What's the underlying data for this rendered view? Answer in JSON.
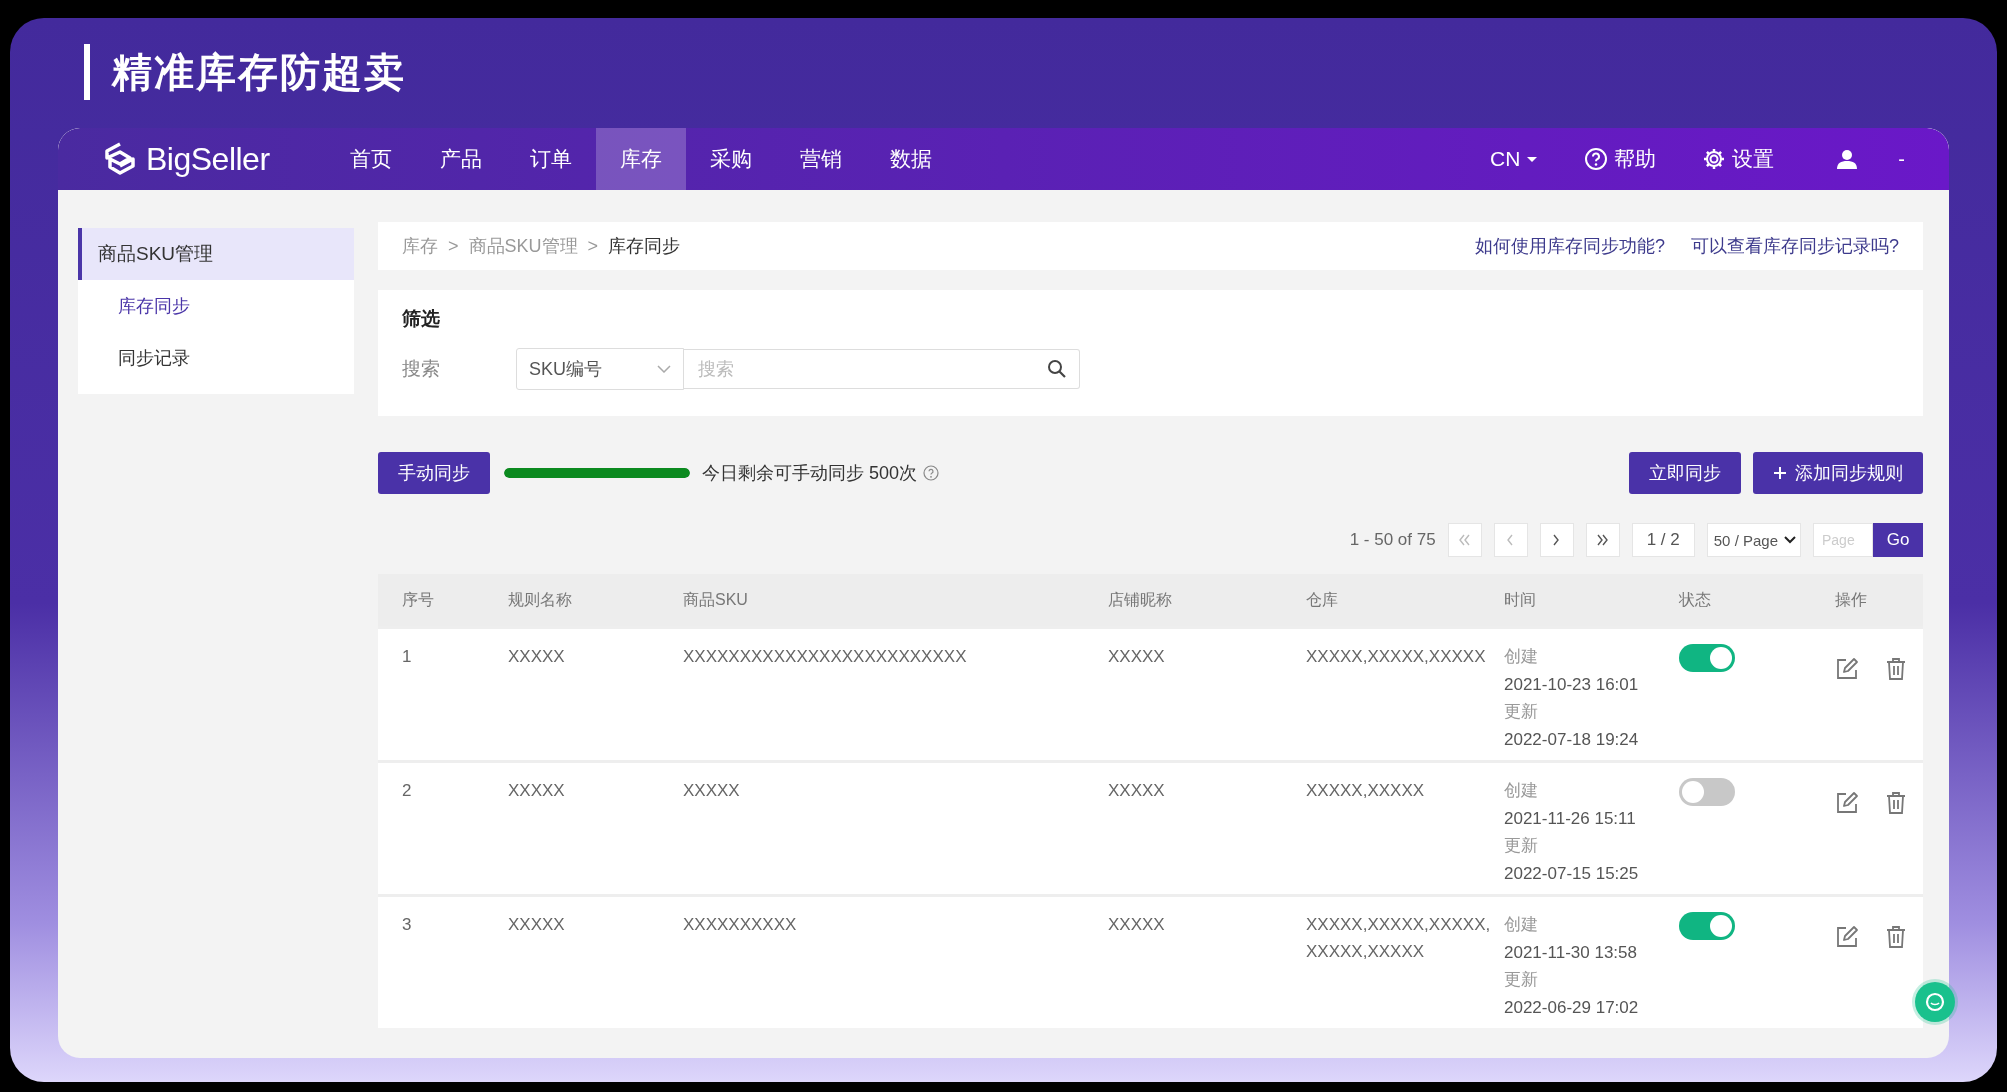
{
  "banner": {
    "title": "精准库存防超卖"
  },
  "top_nav": {
    "logo": "BigSeller",
    "items": [
      {
        "label": "首页",
        "selected": false
      },
      {
        "label": "产品",
        "selected": false
      },
      {
        "label": "订单",
        "selected": false
      },
      {
        "label": "库存",
        "selected": true
      },
      {
        "label": "采购",
        "selected": false
      },
      {
        "label": "营销",
        "selected": false
      },
      {
        "label": "数据",
        "selected": false
      }
    ],
    "language": "CN",
    "help": "帮助",
    "settings": "设置",
    "user": "-"
  },
  "sidebar": {
    "items": [
      {
        "label": "商品SKU管理",
        "selected": true,
        "children": [
          {
            "label": "库存同步",
            "selected": true
          },
          {
            "label": "同步记录",
            "selected": false
          }
        ]
      }
    ]
  },
  "breadcrumb": {
    "items": [
      "库存",
      "商品SKU管理",
      "库存同步"
    ],
    "separators": [
      ">",
      ">"
    ]
  },
  "help_links": [
    "如何使用库存同步功能?",
    "可以查看库存同步记录吗?"
  ],
  "filter": {
    "title": "筛选",
    "search_label": "搜索",
    "search_type": "SKU编号",
    "placeholder": "搜索"
  },
  "actions": {
    "manual_sync": "手动同步",
    "quota": {
      "level": 1.0,
      "text": "今日剩余可手动同步 500次"
    },
    "sync_now": "立即同步",
    "add_rule": "添加同步规则"
  },
  "pagination": {
    "range": "1 - 50 of 75",
    "page": "1 / 2",
    "page_size": "50 / Page",
    "page_placeholder": "Page",
    "go": "Go"
  },
  "table": {
    "columns": [
      "序号",
      "规则名称",
      "商品SKU",
      "店铺昵称",
      "仓库",
      "时间",
      "状态",
      "操作"
    ],
    "rows": [
      {
        "index": "1",
        "rule": "XXXXX",
        "sku": "XXXXXXXXXXXXXXXXXXXXXXXXX",
        "shop": "XXXXX",
        "warehouse": "XXXXX,XXXXX,XXXXX",
        "created_label": "创建",
        "created": "2021-10-23 16:01",
        "updated_label": "更新",
        "updated": "2022-07-18 19:24",
        "enabled": true
      },
      {
        "index": "2",
        "rule": "XXXXX",
        "sku": "XXXXX",
        "shop": "XXXXX",
        "warehouse": "XXXXX,XXXXX",
        "created_label": "创建",
        "created": "2021-11-26 15:11",
        "updated_label": "更新",
        "updated": "2022-07-15 15:25",
        "enabled": false
      },
      {
        "index": "3",
        "rule": "XXXXX",
        "sku": "XXXXXXXXXX",
        "shop": "XXXXX",
        "warehouse": "XXXXX,XXXXX,XXXXX,XXXXX,XXXXX",
        "created_label": "创建",
        "created": "2021-11-30 13:58",
        "updated_label": "更新",
        "updated": "2022-06-29 17:02",
        "enabled": true
      }
    ]
  }
}
